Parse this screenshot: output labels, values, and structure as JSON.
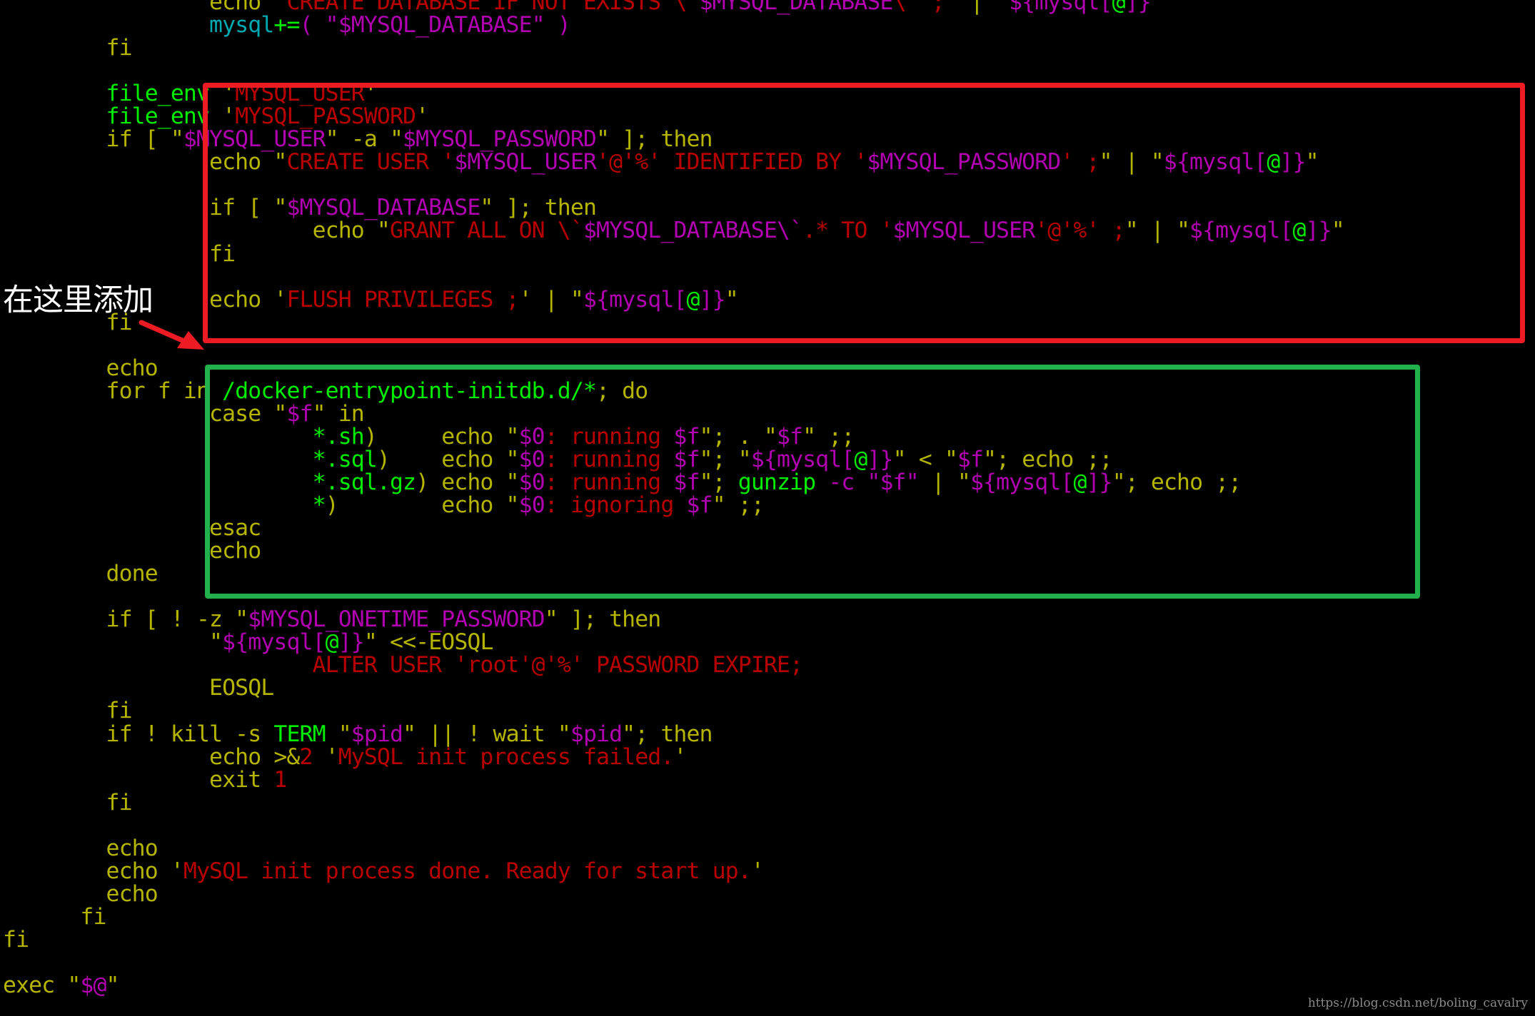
{
  "colors": {
    "background": "#000000",
    "keyword": "#b5b500",
    "string": "#b80000",
    "variable": "#b000b0",
    "builtin": "#00ee00",
    "array": "#00a8b0",
    "red_box": "#ed1c24",
    "green_box": "#22b14c"
  },
  "annotation": {
    "label": "在这里添加",
    "arrow_icon": "red-arrow-icon"
  },
  "watermark": "https://blog.csdn.net/boling_cavalry",
  "code_lines": [
    {
      "indent": 2,
      "tokens": [
        [
          "y",
          "echo \""
        ],
        [
          "r",
          "CREATE DATABASE IF NOT EXISTS \\`"
        ],
        [
          "m",
          "$MYSQL_DATABASE"
        ],
        [
          "r",
          "\\` ;"
        ],
        [
          "y",
          "\" | \""
        ],
        [
          "m",
          "${mysql["
        ],
        [
          "g",
          "@"
        ],
        [
          "m",
          "]}"
        ],
        [
          "y",
          "\""
        ]
      ]
    },
    {
      "indent": 2,
      "tokens": [
        [
          "c",
          "mysql"
        ],
        [
          "g",
          "+="
        ],
        [
          "m",
          "( \"$MYSQL_DATABASE\" )"
        ]
      ]
    },
    {
      "indent": 1,
      "tokens": [
        [
          "y",
          "fi"
        ]
      ]
    },
    {
      "indent": 0,
      "tokens": []
    },
    {
      "indent": 1,
      "tokens": [
        [
          "g",
          "file_env"
        ],
        [
          "y",
          " '"
        ],
        [
          "r",
          "MYSQL_USER"
        ],
        [
          "y",
          "'"
        ]
      ]
    },
    {
      "indent": 1,
      "tokens": [
        [
          "g",
          "file_env"
        ],
        [
          "y",
          " '"
        ],
        [
          "r",
          "MYSQL_PASSWORD"
        ],
        [
          "y",
          "'"
        ]
      ]
    },
    {
      "indent": 1,
      "tokens": [
        [
          "y",
          "if [ \""
        ],
        [
          "m",
          "$MYSQL_USER"
        ],
        [
          "y",
          "\" -a \""
        ],
        [
          "m",
          "$MYSQL_PASSWORD"
        ],
        [
          "y",
          "\" ]; then"
        ]
      ]
    },
    {
      "indent": 2,
      "tokens": [
        [
          "y",
          "echo \""
        ],
        [
          "r",
          "CREATE USER '"
        ],
        [
          "m",
          "$MYSQL_USER"
        ],
        [
          "r",
          "'@'%' IDENTIFIED BY '"
        ],
        [
          "m",
          "$MYSQL_PASSWORD"
        ],
        [
          "r",
          "' ;"
        ],
        [
          "y",
          "\" | \""
        ],
        [
          "m",
          "${mysql["
        ],
        [
          "g",
          "@"
        ],
        [
          "m",
          "]}"
        ],
        [
          "y",
          "\""
        ]
      ]
    },
    {
      "indent": 0,
      "tokens": []
    },
    {
      "indent": 2,
      "tokens": [
        [
          "y",
          "if [ \""
        ],
        [
          "m",
          "$MYSQL_DATABASE"
        ],
        [
          "y",
          "\" ]; then"
        ]
      ]
    },
    {
      "indent": 3,
      "tokens": [
        [
          "y",
          "echo \""
        ],
        [
          "r",
          "GRANT ALL ON \\`"
        ],
        [
          "m",
          "$MYSQL_DATABASE"
        ],
        [
          "m",
          "\\`"
        ],
        [
          "r",
          ".* TO '"
        ],
        [
          "m",
          "$MYSQL_USER"
        ],
        [
          "r",
          "'@'%' ;"
        ],
        [
          "y",
          "\" | \""
        ],
        [
          "m",
          "${mysql["
        ],
        [
          "g",
          "@"
        ],
        [
          "m",
          "]}"
        ],
        [
          "y",
          "\""
        ]
      ]
    },
    {
      "indent": 2,
      "tokens": [
        [
          "y",
          "fi"
        ]
      ]
    },
    {
      "indent": 0,
      "tokens": []
    },
    {
      "indent": 2,
      "tokens": [
        [
          "y",
          "echo '"
        ],
        [
          "r",
          "FLUSH PRIVILEGES ;"
        ],
        [
          "y",
          "' | \""
        ],
        [
          "m",
          "${mysql["
        ],
        [
          "g",
          "@"
        ],
        [
          "m",
          "]}"
        ],
        [
          "y",
          "\""
        ]
      ]
    },
    {
      "indent": 1,
      "tokens": [
        [
          "y",
          "fi"
        ]
      ]
    },
    {
      "indent": 0,
      "tokens": []
    },
    {
      "indent": 1,
      "tokens": [
        [
          "y",
          "echo"
        ]
      ]
    },
    {
      "indent": 1,
      "tokens": [
        [
          "y",
          "for f in "
        ],
        [
          "g",
          "/docker-entrypoint-initdb.d/*"
        ],
        [
          "y",
          "; do"
        ]
      ]
    },
    {
      "indent": 2,
      "tokens": [
        [
          "y",
          "case \""
        ],
        [
          "m",
          "$f"
        ],
        [
          "y",
          "\" in"
        ]
      ]
    },
    {
      "indent": 3,
      "tokens": [
        [
          "g",
          "*.sh"
        ],
        [
          "y",
          ")     echo \""
        ],
        [
          "m",
          "$0"
        ],
        [
          "r",
          ": running "
        ],
        [
          "m",
          "$f"
        ],
        [
          "y",
          "\"; . \""
        ],
        [
          "m",
          "$f"
        ],
        [
          "y",
          "\" ;;"
        ]
      ]
    },
    {
      "indent": 3,
      "tokens": [
        [
          "g",
          "*.sql"
        ],
        [
          "y",
          ")    echo \""
        ],
        [
          "m",
          "$0"
        ],
        [
          "r",
          ": running "
        ],
        [
          "m",
          "$f"
        ],
        [
          "y",
          "\"; \""
        ],
        [
          "m",
          "${mysql["
        ],
        [
          "g",
          "@"
        ],
        [
          "m",
          "]}"
        ],
        [
          "y",
          "\" < \""
        ],
        [
          "m",
          "$f"
        ],
        [
          "y",
          "\"; echo ;;"
        ]
      ]
    },
    {
      "indent": 3,
      "tokens": [
        [
          "g",
          "*.sql.gz"
        ],
        [
          "y",
          ") echo \""
        ],
        [
          "m",
          "$0"
        ],
        [
          "r",
          ": running "
        ],
        [
          "m",
          "$f"
        ],
        [
          "y",
          "\"; "
        ],
        [
          "g",
          "gunzip"
        ],
        [
          "m",
          " -c \"$f\""
        ],
        [
          "y",
          " | \""
        ],
        [
          "m",
          "${mysql["
        ],
        [
          "g",
          "@"
        ],
        [
          "m",
          "]}"
        ],
        [
          "y",
          "\"; echo ;;"
        ]
      ]
    },
    {
      "indent": 3,
      "tokens": [
        [
          "g",
          "*"
        ],
        [
          "y",
          ")        echo \""
        ],
        [
          "m",
          "$0"
        ],
        [
          "r",
          ": ignoring "
        ],
        [
          "m",
          "$f"
        ],
        [
          "y",
          "\" ;;"
        ]
      ]
    },
    {
      "indent": 2,
      "tokens": [
        [
          "y",
          "esac"
        ]
      ]
    },
    {
      "indent": 2,
      "tokens": [
        [
          "y",
          "echo"
        ]
      ]
    },
    {
      "indent": 1,
      "tokens": [
        [
          "y",
          "done"
        ]
      ]
    },
    {
      "indent": 0,
      "tokens": []
    },
    {
      "indent": 1,
      "tokens": [
        [
          "y",
          "if [ ! -z \""
        ],
        [
          "m",
          "$MYSQL_ONETIME_PASSWORD"
        ],
        [
          "y",
          "\" ]; then"
        ]
      ]
    },
    {
      "indent": 2,
      "tokens": [
        [
          "y",
          "\""
        ],
        [
          "m",
          "${mysql["
        ],
        [
          "g",
          "@"
        ],
        [
          "m",
          "]}"
        ],
        [
          "y",
          "\" <<-EOSQL"
        ]
      ]
    },
    {
      "indent": 3,
      "tokens": [
        [
          "r",
          "ALTER USER 'root'@'%' PASSWORD EXPIRE;"
        ]
      ]
    },
    {
      "indent": 2,
      "tokens": [
        [
          "y",
          "EOSQL"
        ]
      ]
    },
    {
      "indent": 1,
      "tokens": [
        [
          "y",
          "fi"
        ]
      ]
    },
    {
      "indent": 1,
      "tokens": [
        [
          "y",
          "if ! kill -s "
        ],
        [
          "g",
          "TERM"
        ],
        [
          "y",
          " \""
        ],
        [
          "m",
          "$pid"
        ],
        [
          "y",
          "\" || ! wait \""
        ],
        [
          "m",
          "$pid"
        ],
        [
          "y",
          "\"; then"
        ]
      ]
    },
    {
      "indent": 2,
      "tokens": [
        [
          "y",
          "echo >&"
        ],
        [
          "r",
          "2"
        ],
        [
          "y",
          " '"
        ],
        [
          "r",
          "MySQL init process failed."
        ],
        [
          "y",
          "'"
        ]
      ]
    },
    {
      "indent": 2,
      "tokens": [
        [
          "y",
          "exit "
        ],
        [
          "r",
          "1"
        ]
      ]
    },
    {
      "indent": 1,
      "tokens": [
        [
          "y",
          "fi"
        ]
      ]
    },
    {
      "indent": 0,
      "tokens": []
    },
    {
      "indent": 1,
      "tokens": [
        [
          "y",
          "echo"
        ]
      ]
    },
    {
      "indent": 1,
      "tokens": [
        [
          "y",
          "echo '"
        ],
        [
          "r",
          "MySQL init process done. Ready for start up."
        ],
        [
          "y",
          "'"
        ]
      ]
    },
    {
      "indent": 1,
      "tokens": [
        [
          "y",
          "echo"
        ]
      ]
    },
    {
      "indent": "half",
      "tokens": [
        [
          "y",
          "fi"
        ]
      ]
    },
    {
      "indent": 0,
      "tokens": [
        [
          "y",
          "fi"
        ]
      ]
    },
    {
      "indent": 0,
      "tokens": []
    },
    {
      "indent": 0,
      "tokens": [
        [
          "y",
          "exec \""
        ],
        [
          "m",
          "$@"
        ],
        [
          "y",
          "\""
        ]
      ]
    }
  ]
}
